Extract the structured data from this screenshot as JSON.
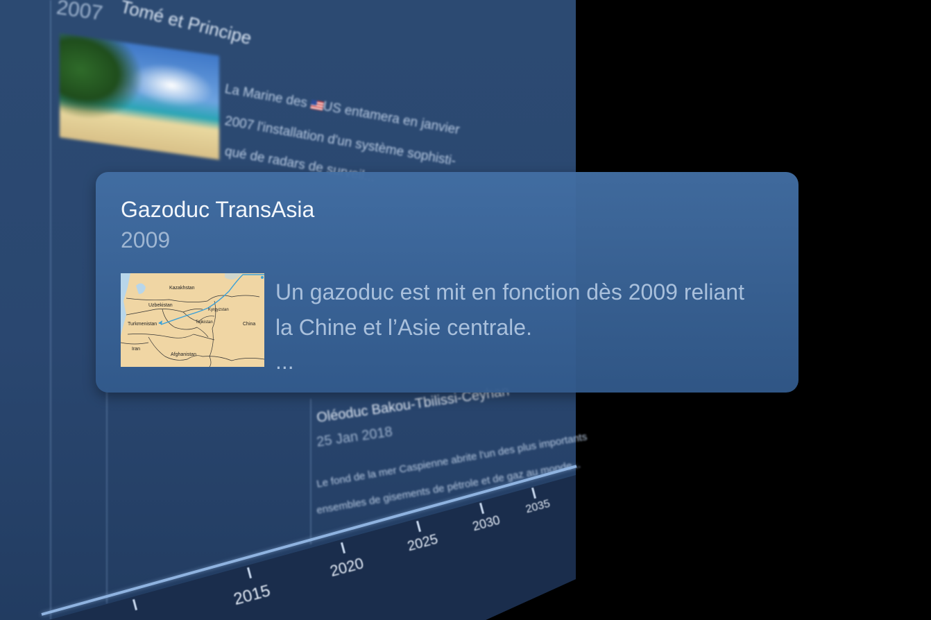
{
  "background_timeline": {
    "top_event": {
      "title": "Tomé et Principe",
      "year": "2007",
      "text_line1": "La Marine des",
      "text_line1b": "US entamera en janvier",
      "text_line2": "2007 l'installation d'un système sophisti-",
      "text_line3": "qué de radars de surveil..."
    },
    "lower_event": {
      "title": "Oléoduc Bakou-Tbilissi-Ceyhan",
      "date": "25 Jan 2018",
      "text_line1": "Le fond de la mer Caspienne abrite l'un des plus importants",
      "text_line2": "ensembles de gisements de pétrole et de gaz au monde..."
    },
    "axis_ticks": [
      "2015",
      "2020",
      "2025",
      "2030",
      "2035"
    ]
  },
  "card": {
    "title": "Gazoduc TransAsia",
    "year": "2009",
    "description": "Un gazoduc est mit en fonction dès 2009 reliant la Chine et l’Asie centrale.",
    "more": "...",
    "map_labels": {
      "kazakhstan": "Kazakhstan",
      "uzbekistan": "Uzbekistan",
      "kyrgyzstan": "Kyrgyzstan",
      "turkmenistan": "Turkmenistan",
      "tajikistan": "Tajikistan",
      "china": "China",
      "iran": "Iran",
      "afghanistan": "Afghanistan"
    }
  },
  "colors": {
    "panel": "#2c4a72",
    "card": "#426ea3",
    "card_title": "#f2f6fb",
    "card_muted": "#a9c0dc",
    "axis_line": "#8fb3e0",
    "pipeline": "#3aa0d8"
  }
}
